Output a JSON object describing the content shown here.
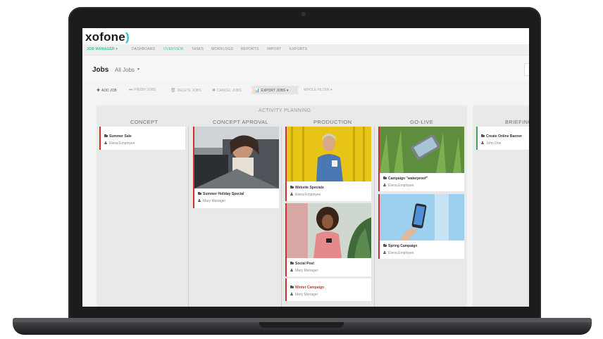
{
  "app": {
    "logo_text": "xofone",
    "logo_paren": ")"
  },
  "nav": {
    "job_manager": "JOB MANAGER ▾",
    "items": [
      "DASHBOARD",
      "OVERVIEW",
      "TASKS",
      "WORKLOGS",
      "REPORTS",
      "IMPORT",
      "EXPORTS"
    ],
    "active": "OVERVIEW"
  },
  "header": {
    "title": "Jobs",
    "filter": "All Jobs",
    "caret": "▾"
  },
  "toolbar": {
    "add_job": "ADD JOB",
    "finish_jobs": "FINISH JOBS",
    "delete_jobs": "DELETE JOBS",
    "cancel_jobs": "CANCEL JOBS",
    "export_jobs": "EXPORT JOBS ▾",
    "whole_filter": "WHOLE FILTER ▾"
  },
  "board": {
    "group_label": "ACTIVITY PLANNING",
    "columns": [
      "CONCEPT",
      "CONCEPT APROVAL",
      "PRODUCTION",
      "GO-LIVE",
      "BRIEFING"
    ]
  },
  "cards": {
    "summer_sale": {
      "title": "Summer Sale",
      "person": "Elena Employee"
    },
    "summer_holiday": {
      "title": "Summer Holiday Special",
      "person": "Mary Manager"
    },
    "website_specials": {
      "title": "Website Specials",
      "person": "Elena Employee"
    },
    "social_post": {
      "title": "Social Post",
      "person": "Mary Manager"
    },
    "winter_campaign": {
      "title": "Winter Campaign",
      "person": "Mary Manager"
    },
    "campaign_waterproof": {
      "title": "Campaign \"waterproof\"",
      "person": "Elena Employee"
    },
    "spring_campaign": {
      "title": "Spring Campaign",
      "person": "Elena Employee"
    },
    "create_online_banner": {
      "title": "Create Online Banner",
      "person": "John Doe"
    }
  },
  "colors": {
    "accent": "#2ec4a0",
    "card_red": "#d32f2f",
    "card_green": "#3aa84a"
  }
}
